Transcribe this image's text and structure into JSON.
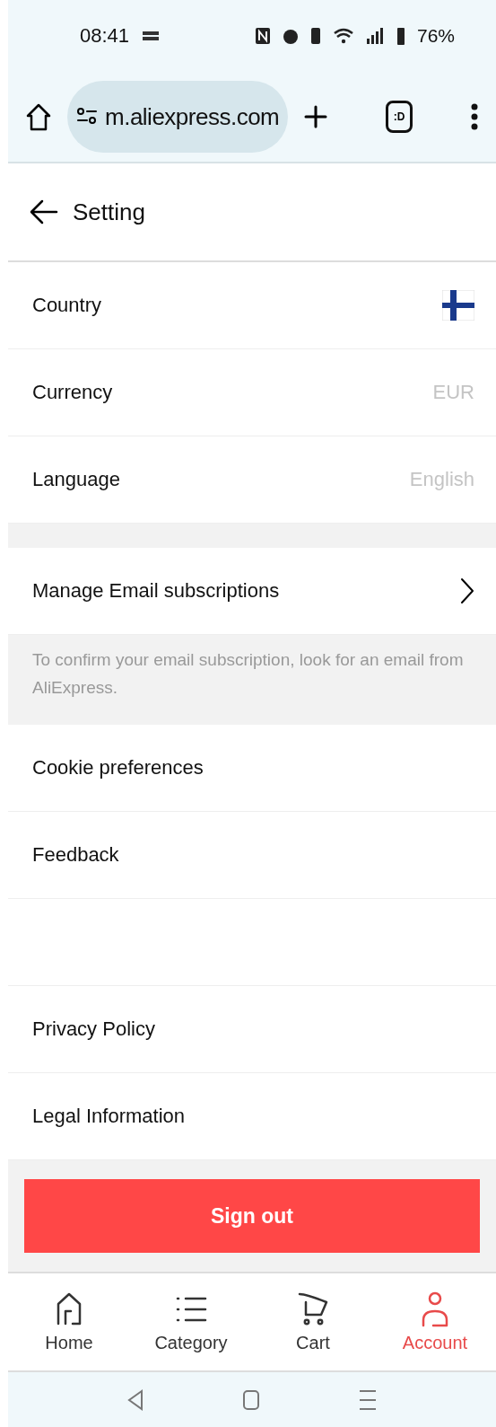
{
  "status_bar": {
    "time": "08:41",
    "battery": "76%"
  },
  "browser": {
    "url": "m.aliexpress.com",
    "tab_label": ":D"
  },
  "header": {
    "title": "Setting"
  },
  "sections": [
    {
      "kind": "rows",
      "rows": [
        {
          "label": "Country",
          "kind": "flag"
        },
        {
          "label": "Currency",
          "kind": "value",
          "value": "EUR"
        },
        {
          "label": "Language",
          "kind": "value",
          "value": "English"
        }
      ]
    },
    {
      "kind": "gap"
    },
    {
      "kind": "rows",
      "rows": [
        {
          "label": "Manage Email subscriptions",
          "kind": "chevron"
        }
      ]
    },
    {
      "kind": "note",
      "text": "To confirm your email subscription, look for an email from AliExpress."
    },
    {
      "kind": "rows",
      "rows": [
        {
          "label": "Cookie preferences",
          "kind": "plain"
        },
        {
          "label": "Feedback",
          "kind": "plain"
        },
        {
          "kind": "blank"
        },
        {
          "label": "Privacy Policy",
          "kind": "plain"
        },
        {
          "label": "Legal Information",
          "kind": "plain"
        }
      ]
    }
  ],
  "sign_out": "Sign out",
  "nav": [
    {
      "label": "Home",
      "selected": false
    },
    {
      "label": "Category",
      "selected": false
    },
    {
      "label": "Cart",
      "selected": false
    },
    {
      "label": "Account",
      "selected": true
    }
  ]
}
